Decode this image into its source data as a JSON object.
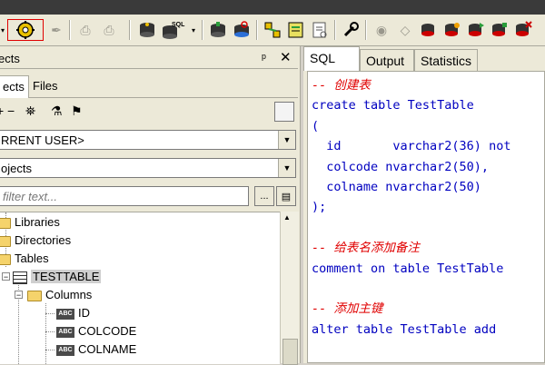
{
  "colors": {
    "toolbar_bg": "#ece9d8",
    "keyword": "#0000c0",
    "comment": "#e00000",
    "selected_border": "#e00000"
  },
  "toolbar": {
    "buttons": [
      "execute-gear-icon",
      "script-icon",
      "print-icon",
      "printer-disabled-icon",
      "db-icon",
      "db-sql-icon",
      "db-blue-icon",
      "db-refresh-icon",
      "schema-icon",
      "edit-script-icon",
      "document-icon",
      "wrench-icon",
      "debug-icon",
      "db-red-icon"
    ],
    "sql_badge": "SQL"
  },
  "left": {
    "title": "ects",
    "pin": "ᵖ",
    "close": "✕",
    "tabs": [
      "ects",
      "Files"
    ],
    "combo_user": "RRENT USER>",
    "combo_objects": "ojects",
    "filter_placeholder": "filter text...",
    "filter_btn": "...",
    "tree": [
      {
        "label": "Libraries"
      },
      {
        "label": "Directories"
      },
      {
        "label": "Tables"
      },
      {
        "label": "TESTTABLE"
      },
      {
        "label": "Columns"
      },
      {
        "label": "ID"
      },
      {
        "label": "COLCODE"
      },
      {
        "label": "COLNAME"
      }
    ]
  },
  "right": {
    "tabs": [
      "SQL",
      "Output",
      "Statistics"
    ],
    "code": [
      {
        "type": "comment",
        "text": "-- 创建表"
      },
      {
        "type": "code",
        "text": "create table TestTable"
      },
      {
        "type": "code",
        "text": "("
      },
      {
        "type": "code",
        "text": "  id       varchar2(36) not"
      },
      {
        "type": "code",
        "text": "  colcode nvarchar2(50),"
      },
      {
        "type": "code",
        "text": "  colname nvarchar2(50)"
      },
      {
        "type": "code",
        "text": ");"
      },
      {
        "type": "blank",
        "text": ""
      },
      {
        "type": "comment",
        "text": "-- 给表名添加备注"
      },
      {
        "type": "code",
        "text": "comment on table TestTable"
      },
      {
        "type": "blank",
        "text": ""
      },
      {
        "type": "comment",
        "text": "-- 添加主键"
      },
      {
        "type": "code",
        "text": "alter table TestTable add"
      }
    ]
  }
}
